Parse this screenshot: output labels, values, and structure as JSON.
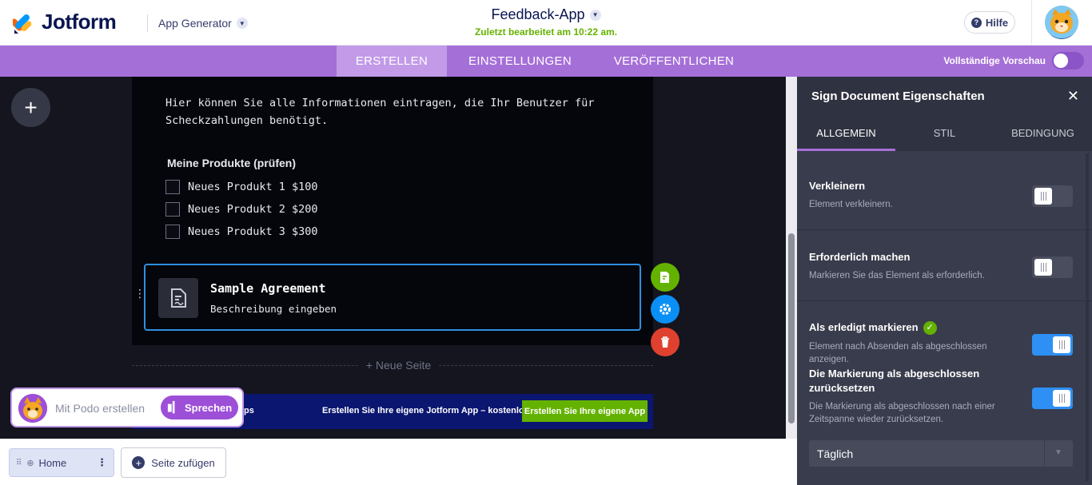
{
  "header": {
    "brand": "Jotform",
    "app_generator": "App Generator",
    "app_title": "Feedback-App",
    "last_edited": "Zuletzt bearbeitet am 10:22 am.",
    "help": "Hilfe"
  },
  "nav": {
    "tabs": [
      {
        "label": "ERSTELLEN",
        "active": true
      },
      {
        "label": "EINSTELLUNGEN",
        "active": false
      },
      {
        "label": "VERÖFFENTLICHEN",
        "active": false
      }
    ],
    "full_preview_label": "Vollständige Vorschau",
    "full_preview_on": false
  },
  "form": {
    "description_line1": "Hier können Sie alle Informationen eintragen, die Ihr Benutzer für",
    "description_line2": "Scheckzahlungen benötigt.",
    "products_title": "Meine Produkte (prüfen)",
    "products": [
      "Neues Produkt 1 $100",
      "Neues Produkt 2 $200",
      "Neues Produkt 3 $300"
    ],
    "agreement_title": "Sample Agreement",
    "agreement_desc": "Beschreibung eingeben",
    "new_page": "+ Neue Seite"
  },
  "banner": {
    "left_text": "ps",
    "mid_text": "Erstellen Sie Ihre eigene Jotform App – kostenlos",
    "cta": "Erstellen Sie Ihre eigene App"
  },
  "podo": {
    "prompt": "Mit Podo erstellen",
    "speak": "Sprechen"
  },
  "pages": {
    "home": "Home",
    "add_page": "Seite zufügen"
  },
  "panel": {
    "title": "Sign Document Eigenschaften",
    "tabs": [
      {
        "label": "ALLGEMEIN",
        "active": true
      },
      {
        "label": "STIL",
        "active": false
      },
      {
        "label": "BEDINGUNG",
        "active": false
      }
    ],
    "shrink_title": "Verkleinern",
    "shrink_desc": "Element verkleinern.",
    "shrink_on": false,
    "required_title": "Erforderlich machen",
    "required_desc": "Markieren Sie das Element als erforderlich.",
    "required_on": false,
    "done_title": "Als erledigt markieren",
    "done_desc": "Element nach Absenden als abgeschlossen anzeigen.",
    "done_on": true,
    "reset_title": "Die Markierung als abgeschlossen zurücksetzen",
    "reset_desc": "Die Markierung als abgeschlossen nach einer Zeitspanne wieder zurücksetzen.",
    "reset_on": true,
    "interval": "Täglich"
  },
  "colors": {
    "accent_purple": "#a56fd8",
    "toggle_on": "#2e8ff5",
    "success_green": "#64b200",
    "focus_blue": "#2f8fe0",
    "delete_red": "#e0412f"
  }
}
